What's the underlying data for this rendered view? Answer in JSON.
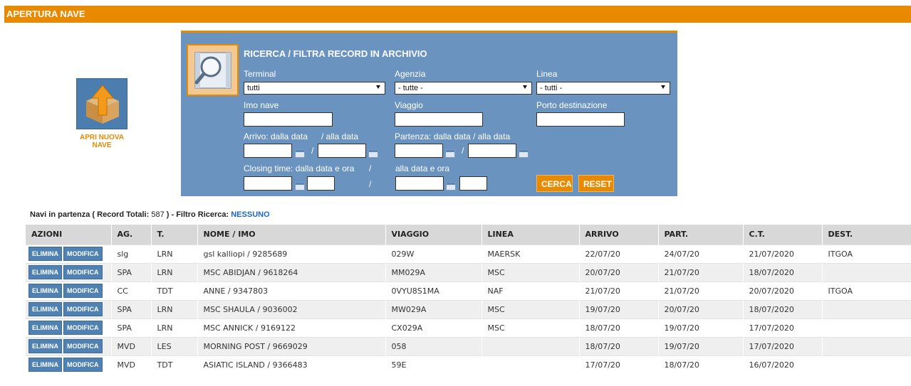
{
  "page": {
    "title": "APERTURA NAVE"
  },
  "new_ship": {
    "label_line1": "APRI NUOVA",
    "label_line2": "NAVE",
    "icon": "box-upload-icon"
  },
  "search": {
    "title": "RICERCA / FILTRA RECORD IN ARCHIVIO",
    "icon": "search-icon",
    "terminal_label": "Terminal",
    "terminal_value": "tutti",
    "agenzia_label": "Agenzia",
    "agenzia_value": "- tutte -",
    "linea_label": "Linea",
    "linea_value": "- tutti -",
    "imo_label": "Imo nave",
    "imo_value": "",
    "viaggio_label": "Viaggio",
    "viaggio_value": "",
    "porto_label": "Porto destinazione",
    "porto_value": "",
    "arrivo_label_from": "Arrivo: dalla data",
    "arrivo_label_to": "/  alla data",
    "partenza_label": "Partenza: dalla data  /  alla data",
    "closing_label_from": "Closing time: dalla data e ora",
    "closing_sep": "/",
    "closing_label_to": "alla data e ora",
    "slash": "/",
    "cerca_label": "CERCA",
    "reset_label": "RESET"
  },
  "summary": {
    "prefix": "Navi in partenza ( Record Totali:",
    "total": "587",
    "middle": ") - Filtro Ricerca:",
    "filter": "NESSUNO"
  },
  "table": {
    "headers": {
      "azioni": "AZIONI",
      "ag": "AG.",
      "t": "T.",
      "nome": "NOME / IMO",
      "viaggio": "VIAGGIO",
      "linea": "LINEA",
      "arrivo": "ARRIVO",
      "part": "PART.",
      "ct": "C.T.",
      "dest": "DEST."
    },
    "elimina_label": "ELIMINA",
    "modifica_label": "MODIFICA",
    "rows": [
      {
        "ag": "slg",
        "t": "LRN",
        "nome": "gsl kalliopi / 9285689",
        "viaggio": "029W",
        "linea": "MAERSK",
        "arrivo": "22/07/20",
        "part": "24/07/20",
        "ct": "21/07/2020",
        "dest": "ITGOA"
      },
      {
        "ag": "SPA",
        "t": "LRN",
        "nome": "MSC ABIDJAN / 9618264",
        "viaggio": "MM029A",
        "linea": "MSC",
        "arrivo": "20/07/20",
        "part": "21/07/20",
        "ct": "18/07/2020",
        "dest": ""
      },
      {
        "ag": "CC",
        "t": "TDT",
        "nome": "ANNE / 9347803",
        "viaggio": "0VYU8S1MA",
        "linea": "NAF",
        "arrivo": "21/07/20",
        "part": "21/07/20",
        "ct": "20/07/2020",
        "dest": "ITGOA"
      },
      {
        "ag": "SPA",
        "t": "LRN",
        "nome": "MSC SHAULA / 9036002",
        "viaggio": "MW029A",
        "linea": "MSC",
        "arrivo": "19/07/20",
        "part": "20/07/20",
        "ct": "18/07/2020",
        "dest": ""
      },
      {
        "ag": "SPA",
        "t": "LRN",
        "nome": "MSC ANNICK / 9169122",
        "viaggio": "CX029A",
        "linea": "MSC",
        "arrivo": "18/07/20",
        "part": "19/07/20",
        "ct": "17/07/2020",
        "dest": ""
      },
      {
        "ag": "MVD",
        "t": "LES",
        "nome": "MORNING POST / 9669029",
        "viaggio": "058",
        "linea": "",
        "arrivo": "18/07/20",
        "part": "19/07/20",
        "ct": "17/07/2020",
        "dest": ""
      },
      {
        "ag": "MVD",
        "t": "TDT",
        "nome": "ASIATIC ISLAND / 9366483",
        "viaggio": "59E",
        "linea": "",
        "arrivo": "17/07/20",
        "part": "18/07/20",
        "ct": "16/07/2020",
        "dest": ""
      }
    ]
  }
}
